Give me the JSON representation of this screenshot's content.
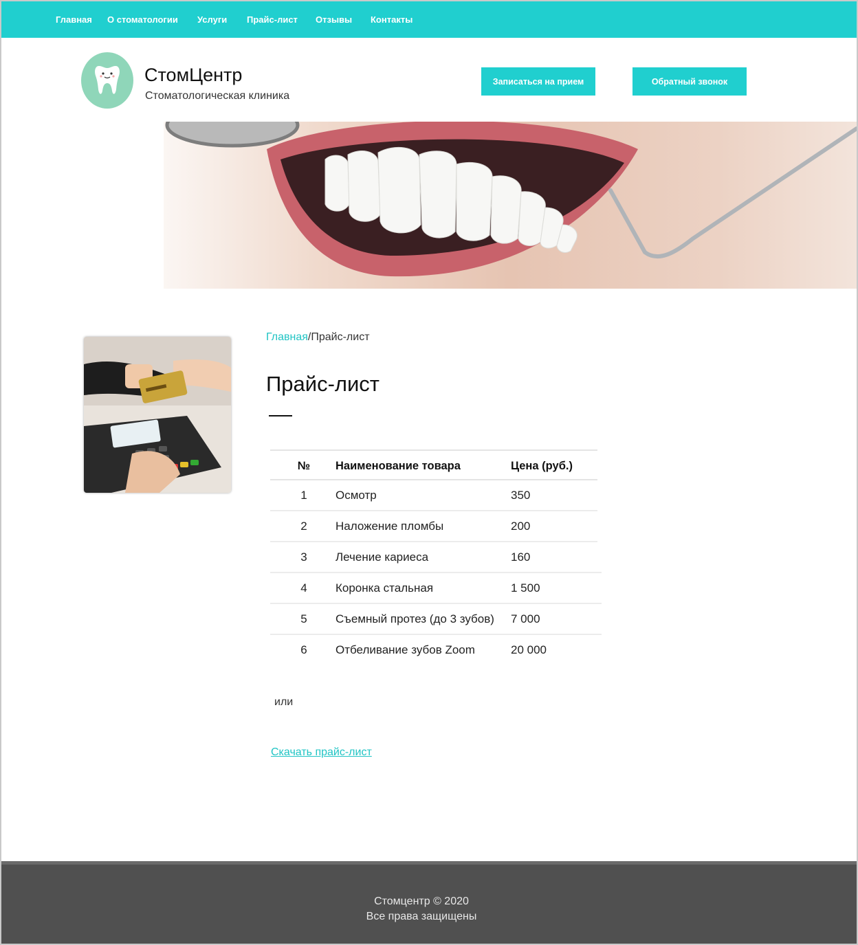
{
  "nav": {
    "items": [
      "Главная",
      "О стоматологии",
      "Услуги",
      "Прайс-лист",
      "Отзывы",
      "Контакты"
    ]
  },
  "header": {
    "logo_icon": "tooth-icon",
    "brand_name": "СтомЦентр",
    "brand_subtitle": "Стоматологическая клиника",
    "appointment_button": "Записаться на прием",
    "callback_button": "Обратный звонок"
  },
  "hero": {
    "image": "smile-with-dental-mirror"
  },
  "sidebar": {
    "image": "card-payment-terminal"
  },
  "breadcrumb": {
    "home": "Главная",
    "separator": "/",
    "current": "Прайс-лист"
  },
  "page": {
    "title": "Прайс-лист"
  },
  "price_table": {
    "headers": [
      "№",
      "Наименование товара",
      "Цена (руб.)"
    ],
    "rows": [
      [
        "1",
        "Осмотр",
        "350"
      ],
      [
        "2",
        "Наложение пломбы",
        "200"
      ],
      [
        "3",
        "Лечение кариеса",
        "160"
      ],
      [
        "4",
        "Коронка стальная",
        "1 500"
      ],
      [
        "5",
        "Съемный протез (до 3 зубов)",
        "7 000"
      ],
      [
        "6",
        "Отбеливание зубов Zoom",
        "20 000"
      ]
    ]
  },
  "or_text": "или",
  "download_link": "Скачать прайс-лист",
  "footer": {
    "line1": "Стомцентр © 2020",
    "line2": "Все права защищены"
  },
  "colors": {
    "accent": "#20cfcf",
    "link": "#20c4c4",
    "footer": "#505050"
  }
}
